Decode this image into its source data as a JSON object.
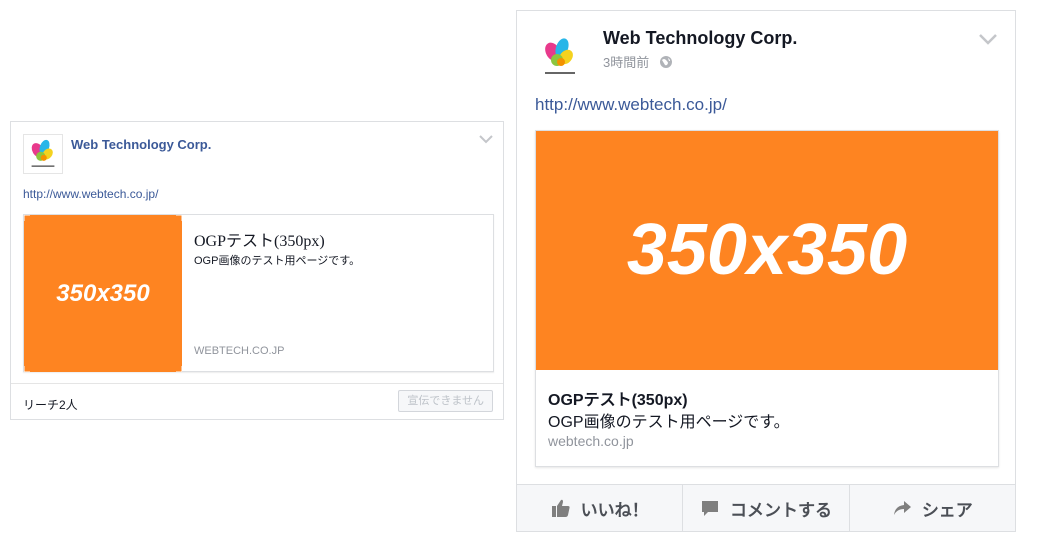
{
  "left_post": {
    "page_name": "Web Technology Corp.",
    "link": "http://www.webtech.co.jp/",
    "thumbnail_text": "350x350",
    "og_title": "OGPテスト(350px)",
    "og_description": "OGP画像のテスト用ページです。",
    "og_domain": "WEBTECH.CO.JP",
    "reach": "リーチ2人",
    "boost_label": "宣伝できません"
  },
  "right_post": {
    "page_name": "Web Technology Corp.",
    "timestamp": "3時間前",
    "link": "http://www.webtech.co.jp/",
    "image_text": "350x350",
    "og_title": "OGPテスト(350px)",
    "og_description": "OGP画像のテスト用ページです。",
    "og_domain": "webtech.co.jp",
    "actions": {
      "like": "いいね！",
      "comment": "コメントする",
      "share": "シェア"
    }
  },
  "icons": {
    "logo": "web-technology-logo",
    "privacy": "globe-icon",
    "menu": "chevron-down-icon",
    "like": "thumbs-up-icon",
    "comment": "speech-bubble-icon",
    "share": "share-arrow-icon"
  },
  "colors": {
    "accent_orange": "#fe8421",
    "link_blue": "#3b5998",
    "muted_gray": "#90949c"
  }
}
